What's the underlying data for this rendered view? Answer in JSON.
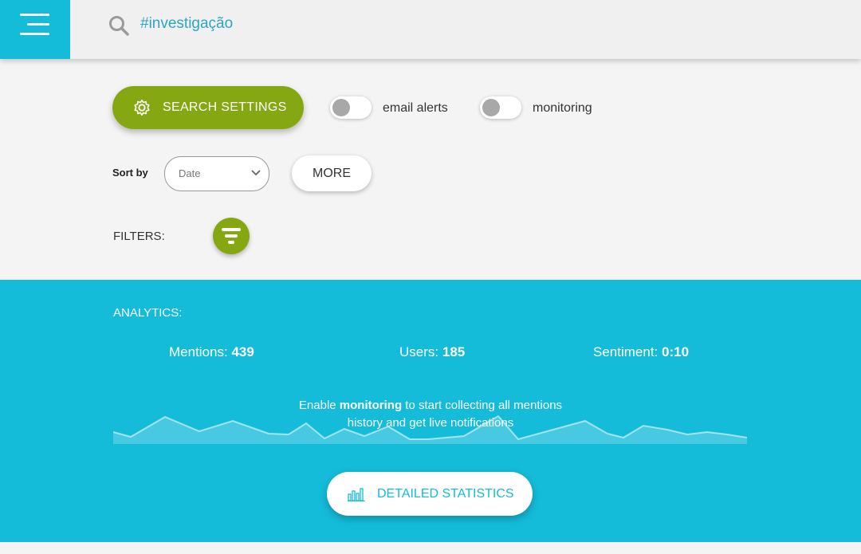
{
  "header": {
    "search_text": "#investigação"
  },
  "controls": {
    "search_settings_label": "SEARCH SETTINGS",
    "email_alerts_label": "email alerts",
    "monitoring_label": "monitoring",
    "sort_by_label": "Sort by",
    "sort_value": "Date",
    "more_label": "MORE",
    "filters_label": "FILTERS:"
  },
  "analytics": {
    "title": "ANALYTICS:",
    "mentions_label": "Mentions:",
    "mentions_value": "439",
    "users_label": "Users:",
    "users_value": "185",
    "sentiment_label": "Sentiment:",
    "sentiment_value": "0:10",
    "notice_pre": "Enable ",
    "notice_bold": "monitoring",
    "notice_post": " to start collecting all mentions history and get live notifications",
    "stats_button_label": "DETAILED STATISTICS"
  },
  "colors": {
    "accent_cyan": "#14bcd9",
    "accent_green": "#84a712"
  }
}
